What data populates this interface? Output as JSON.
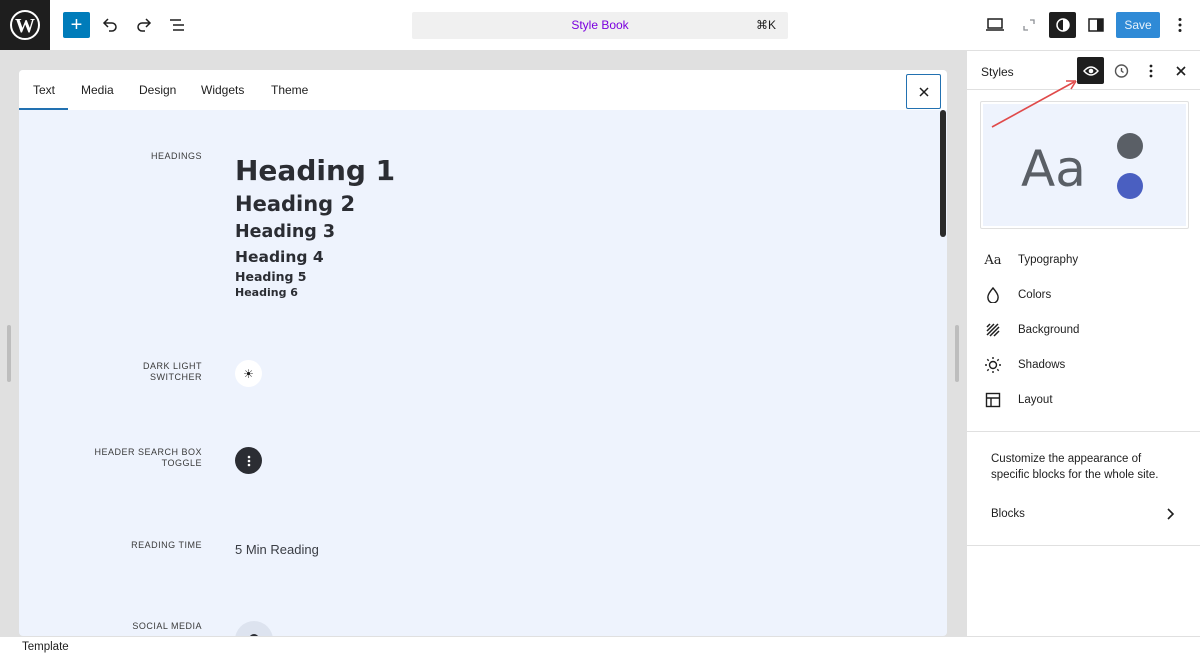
{
  "topbar": {
    "logo": "wordpress-logo",
    "add_label": "+",
    "command_title": "Style Book",
    "command_shortcut": "⌘K",
    "save_label": "Save"
  },
  "stylebook": {
    "tabs": [
      "Text",
      "Media",
      "Design",
      "Widgets",
      "Theme"
    ],
    "active_tab": "Text",
    "rows": {
      "headings_label": "HEADINGS",
      "headings": [
        "Heading 1",
        "Heading 2",
        "Heading 3",
        "Heading 4",
        "Heading 5",
        "Heading 6"
      ],
      "dark_light_label": "DARK LIGHT SWITCHER",
      "header_search_label": "HEADER SEARCH BOX TOGGLE",
      "reading_time_label": "READING TIME",
      "reading_time_value": "5 Min Reading",
      "social_media_label": "SOCIAL MEDIA"
    }
  },
  "sidebar": {
    "title": "Styles",
    "preview_text": "Aa",
    "colors": {
      "dot1": "#5a5f66",
      "dot2": "#4a5fc1"
    },
    "items": [
      {
        "label": "Typography",
        "icon": "typography-icon"
      },
      {
        "label": "Colors",
        "icon": "droplet-icon"
      },
      {
        "label": "Background",
        "icon": "background-icon"
      },
      {
        "label": "Shadows",
        "icon": "shadow-icon"
      },
      {
        "label": "Layout",
        "icon": "layout-icon"
      }
    ],
    "description": "Customize the appearance of specific blocks for the whole site.",
    "blocks_label": "Blocks"
  },
  "footer": {
    "label": "Template"
  },
  "accent": "#2271b1"
}
